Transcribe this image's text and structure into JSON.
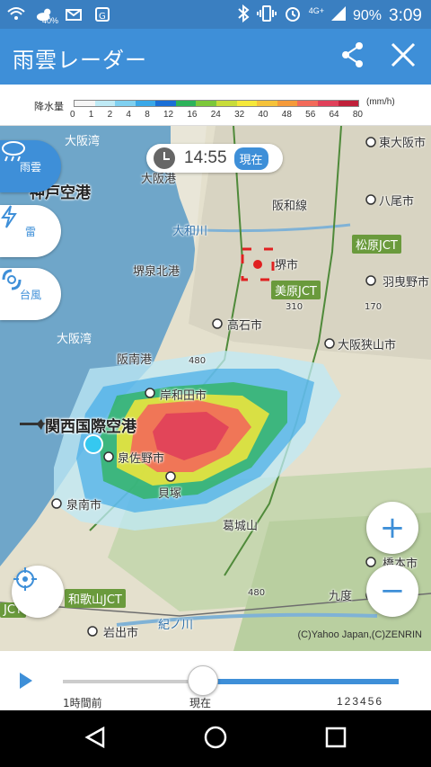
{
  "status_bar": {
    "battery_signal": "40%",
    "network": "4G+",
    "battery": "90%",
    "time": "3:09",
    "icons": [
      "wifi-settings-icon",
      "cloud-sun-icon",
      "mail-icon",
      "map-icon",
      "bluetooth-icon",
      "vibrate-icon",
      "alarm-icon",
      "signal-icon"
    ]
  },
  "app_bar": {
    "title": "雨雲レーダー",
    "share_icon": "share-icon",
    "close_icon": "close-icon"
  },
  "legend": {
    "label": "降水量",
    "ticks": [
      "0",
      "1",
      "2",
      "4",
      "8",
      "12",
      "16",
      "24",
      "32",
      "40",
      "48",
      "56",
      "64",
      "80"
    ],
    "unit": "(mm/h)",
    "colors": [
      "#f5f5f5",
      "#bfeaf5",
      "#7fd0f0",
      "#3aa8e8",
      "#1a6fd6",
      "#2db35a",
      "#7cc83a",
      "#c8dc3a",
      "#f5e83a",
      "#f5c23a",
      "#f59a3a",
      "#f26a5a",
      "#e0405a",
      "#c0203a"
    ]
  },
  "map": {
    "time": "14:55",
    "now_badge": "現在",
    "labels": {
      "osaka_bay_n": "大阪湾",
      "osaka_bay_s": "大阪湾",
      "kobe_airport": "神戸空港",
      "osaka_port": "大阪港",
      "yamato_river": "大和川",
      "hanwa_line": "阪和線",
      "sakai_senboku": "堺泉北港",
      "sakai_city": "堺市",
      "higashi_osaka": "東大阪市",
      "yao": "八尾市",
      "matsubara_jct": "松原JCT",
      "habikino": "羽曳野市",
      "mihara_jct": "美原JCT",
      "takaishi": "高石市",
      "hannan_port": "阪南港",
      "osakasayama": "大阪狭山市",
      "kishiwada": "岸和田市",
      "kix": "関西国際空港",
      "izumisano": "泉佐野市",
      "kaizuka": "貝塚",
      "sennan": "泉南市",
      "katsuragi": "葛城山",
      "hashimoto": "橋本市",
      "wakayama_jct": "和歌山JCT",
      "kudoyama": "九度",
      "iwade": "岩出市",
      "kinokawa": "紀ノ川",
      "route_310": "310",
      "route_170": "170",
      "route_480_n": "480",
      "route_480_s": "480",
      "jct_left": "JCT"
    },
    "copyright": "(C)Yahoo Japan,(C)ZENRIN"
  },
  "side_buttons": [
    {
      "label": "雨雲",
      "icon": "rain-cloud-icon",
      "active": true
    },
    {
      "label": "雷",
      "icon": "lightning-icon",
      "active": false
    },
    {
      "label": "台風",
      "icon": "typhoon-icon",
      "active": false
    }
  ],
  "controls": {
    "zoom_in": "+",
    "zoom_out": "−",
    "locate_icon": "locate-icon"
  },
  "playback": {
    "label_past": "1時間前",
    "label_now": "現在",
    "label_future": "123456"
  }
}
